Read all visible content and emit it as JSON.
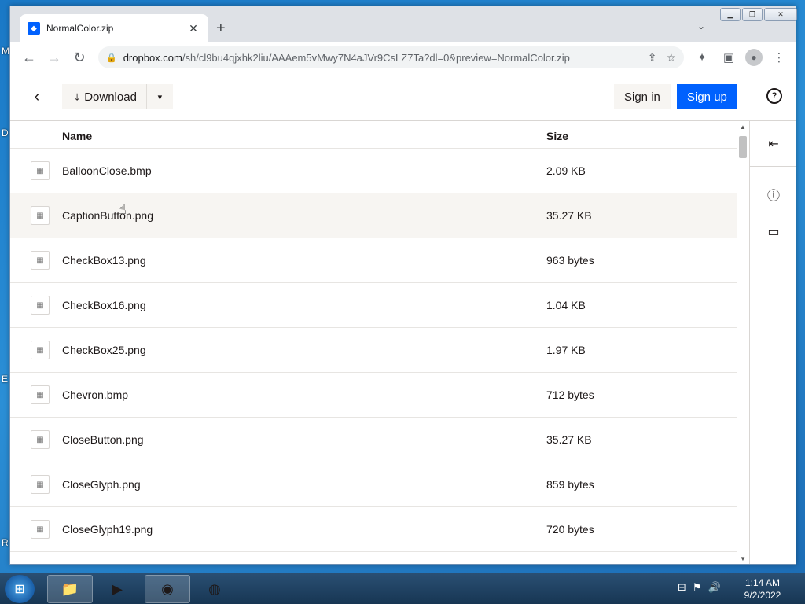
{
  "desktop": {
    "edge_glyphs": [
      "M",
      "D",
      "E",
      "R"
    ]
  },
  "browser": {
    "tab_title": "NormalColor.zip",
    "tab_favicon": "dropbox-icon",
    "new_tab_glyph": "+",
    "url_host": "dropbox.com",
    "url_path": "/sh/cl9bu4qjxhk2liu/AAAem5vMwy7N4aJVr9CsLZ7Ta?dl=0&preview=NormalColor.zip",
    "accent": "#0061fe"
  },
  "page": {
    "download_label": "Download",
    "signin_label": "Sign in",
    "signup_label": "Sign up",
    "help_glyph": "?",
    "columns": {
      "name": "Name",
      "size": "Size"
    },
    "files": [
      {
        "name": "BalloonClose.bmp",
        "size": "2.09 KB"
      },
      {
        "name": "CaptionButton.png",
        "size": "35.27 KB"
      },
      {
        "name": "CheckBox13.png",
        "size": "963 bytes"
      },
      {
        "name": "CheckBox16.png",
        "size": "1.04 KB"
      },
      {
        "name": "CheckBox25.png",
        "size": "1.97 KB"
      },
      {
        "name": "Chevron.bmp",
        "size": "712 bytes"
      },
      {
        "name": "CloseButton.png",
        "size": "35.27 KB"
      },
      {
        "name": "CloseGlyph.png",
        "size": "859 bytes"
      },
      {
        "name": "CloseGlyph19.png",
        "size": "720 bytes"
      }
    ]
  },
  "taskbar": {
    "time": "1:14 AM",
    "date": "9/2/2022"
  }
}
